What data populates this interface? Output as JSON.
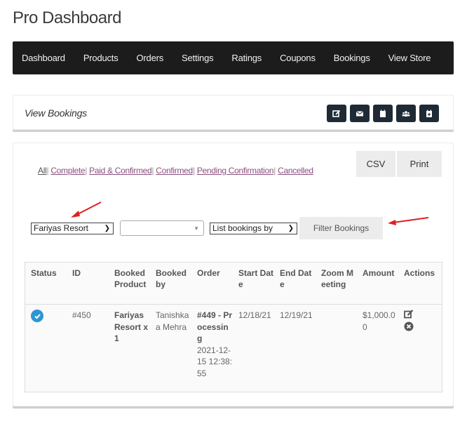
{
  "page": {
    "title": "Pro Dashboard"
  },
  "nav": {
    "items": [
      {
        "label": "Dashboard"
      },
      {
        "label": "Products"
      },
      {
        "label": "Orders"
      },
      {
        "label": "Settings"
      },
      {
        "label": "Ratings"
      },
      {
        "label": "Coupons"
      },
      {
        "label": "Bookings"
      },
      {
        "label": "View Store"
      }
    ]
  },
  "header_card": {
    "title": "View Bookings",
    "actions": [
      {
        "icon": "edit-icon"
      },
      {
        "icon": "envelope-icon"
      },
      {
        "icon": "calendar-icon"
      },
      {
        "icon": "users-icon"
      },
      {
        "icon": "calendar-plus-icon"
      }
    ]
  },
  "export": {
    "csv_label": "CSV",
    "print_label": "Print"
  },
  "status_filters": [
    {
      "label": "All",
      "active": true
    },
    {
      "label": "Complete"
    },
    {
      "label": "Paid & Confirmed"
    },
    {
      "label": "Confirmed"
    },
    {
      "label": "Pending Confirmation"
    },
    {
      "label": "Cancelled"
    }
  ],
  "filters": {
    "product_selected": "Fariyas Resort",
    "second_selected": "",
    "list_by_selected": "List bookings by",
    "filter_button": "Filter Bookings"
  },
  "table": {
    "headers": [
      "Status",
      "ID",
      "Booked Product",
      "Booked by",
      "Order",
      "Start Date",
      "End Date",
      "Zoom Meeting",
      "Amount",
      "Actions"
    ],
    "rows": [
      {
        "status": "complete",
        "id": "#450",
        "product": "Fariyas Resort x 1",
        "booked_by": "Tanishkaa Mehra",
        "order": "#449 - Processing",
        "order_date": "2021-12-15 12:38:55",
        "start_date": "12/18/21",
        "end_date": "12/19/21",
        "zoom_meeting": "",
        "amount": "$1,000.00"
      }
    ]
  },
  "colors": {
    "nav_bg": "#1c1c1c",
    "icon_btn_bg": "#1e2b36",
    "link": "#8a4f7d",
    "status_check": "#2e95d3",
    "annotation_arrow": "#e02020"
  }
}
